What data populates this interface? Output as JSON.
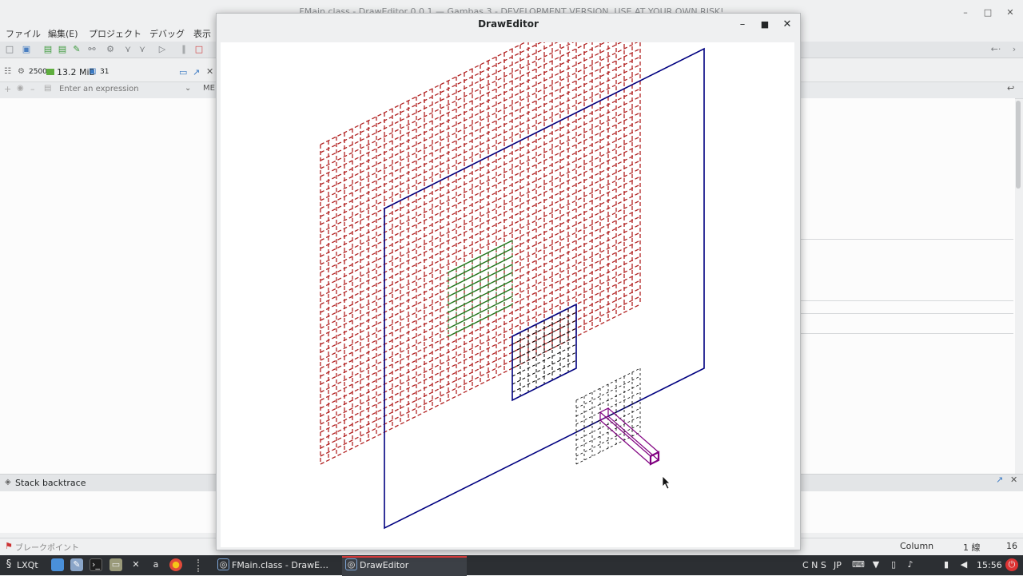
{
  "ide": {
    "title": "FMain.class - DrawEditor 0.0.1 — Gambas 3 - DEVELOPMENT VERSION, USE AT YOUR OWN RISK!",
    "menu": [
      "ファイル",
      "編集(E)",
      "プロジェクト",
      "デバッグ",
      "表示"
    ],
    "debug_bar": {
      "value": "2500",
      "memory": "13.2 MiB",
      "count": "31"
    },
    "expression_placeholder": "Enter an expression",
    "expr_tab": "ME",
    "stack_backtrace": "Stack backtrace",
    "breakpoints": "ブレークポイント",
    "status": {
      "column_label": "Column",
      "line": "1 線",
      "column": "16"
    }
  },
  "draw_window": {
    "title": "DrawEditor",
    "colors": {
      "red_grid": "#b22222",
      "blue_frame": "#000080",
      "green_grid": "#1e7b1e",
      "black_grid": "#000000",
      "purple_box": "#800080"
    }
  },
  "taskbar": {
    "start_label": "LXQt",
    "tasks": [
      "FMain.class - DrawE…",
      "DrawEditor"
    ],
    "tray": {
      "keys": "C N S",
      "lang": "JP",
      "clock": "15:56"
    }
  }
}
